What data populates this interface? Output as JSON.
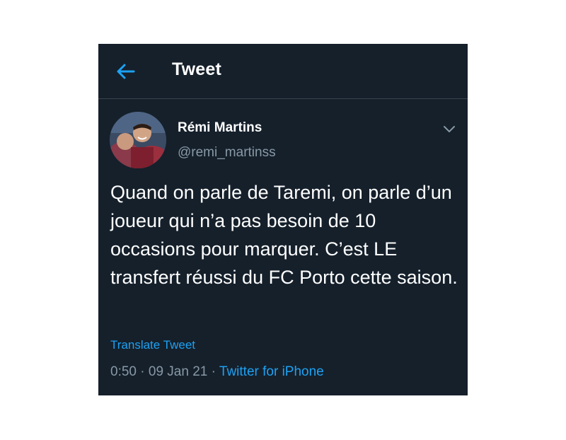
{
  "header": {
    "title": "Tweet",
    "back_icon": "arrow-left-icon"
  },
  "author": {
    "name": "Rémi Martins",
    "handle": "@remi_martinss"
  },
  "menu_icon": "chevron-down-icon",
  "tweet": {
    "text": "Quand on parle de Taremi, on parle d’un joueur qui n’a pas besoin de 10 occasions pour marquer. C’est LE transfert réussi du FC Porto cette saison.",
    "translate_label": "Translate Tweet",
    "time": "0:50",
    "date": "09 Jan 21",
    "separator": "·",
    "source": "Twitter for iPhone"
  },
  "colors": {
    "background": "#15202b",
    "accent": "#1da1f2",
    "secondary_text": "#8899a6",
    "divider": "#38444d"
  }
}
